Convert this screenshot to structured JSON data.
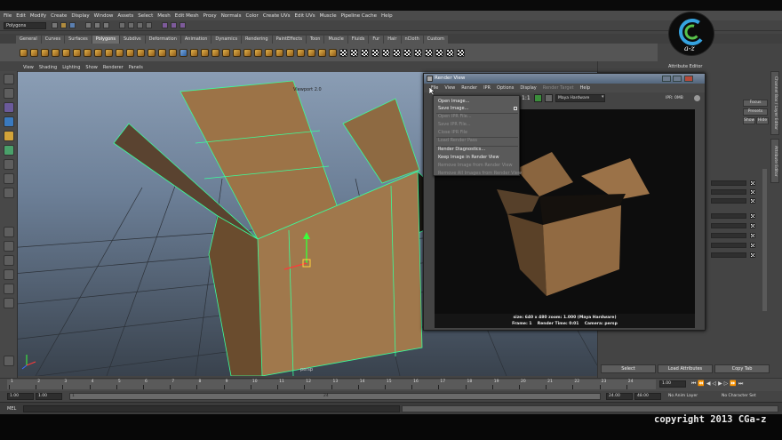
{
  "menubar": [
    "File",
    "Edit",
    "Modify",
    "Create",
    "Display",
    "Window",
    "Assets",
    "Select",
    "Mesh",
    "Edit Mesh",
    "Proxy",
    "Normals",
    "Color",
    "Create UVs",
    "Edit UVs",
    "Muscle",
    "Pipeline Cache",
    "Help"
  ],
  "mode_selector": "Polygons",
  "shelf_tabs": [
    "General",
    "Curves",
    "Surfaces",
    "Polygons",
    "Subdivs",
    "Deformation",
    "Animation",
    "Dynamics",
    "Rendering",
    "PaintEffects",
    "Toon",
    "Muscle",
    "Fluids",
    "Fur",
    "Hair",
    "nCloth",
    "Custom"
  ],
  "active_shelf_tab": "Polygons",
  "viewport": {
    "menu": [
      "View",
      "Shading",
      "Lighting",
      "Show",
      "Renderer",
      "Panels"
    ],
    "label": "Viewport 2.0",
    "bottom_label": "persp"
  },
  "render_view": {
    "title": "Render View",
    "menu": [
      "File",
      "View",
      "Render",
      "IPR",
      "Options",
      "Display",
      "Render Target",
      "Help"
    ],
    "renderer": "Maya Hardware",
    "ratio": "1:1",
    "ipr_memory": "IPR: 0MB",
    "info_line1": "size: 640 x 480  zoom: 1.000        (Maya Hardware)",
    "info_frame": "Frame: 1",
    "info_time": "Render Time: 0:01",
    "info_camera": "Camera: persp"
  },
  "file_menu": [
    {
      "label": "Open Image...",
      "enabled": true
    },
    {
      "label": "Save Image...",
      "enabled": true
    },
    {
      "label": "Open IPR File...",
      "enabled": false
    },
    {
      "label": "Save IPR File...",
      "enabled": false
    },
    {
      "label": "Close IPR File",
      "enabled": false
    },
    {
      "label": "Load Render Pass",
      "enabled": false
    },
    {
      "label": "Render Diagnostics...",
      "enabled": true
    },
    {
      "label": "Keep Image in Render View",
      "enabled": true
    },
    {
      "label": "Remove Image from Render View",
      "enabled": false
    },
    {
      "label": "Remove All Images from Render View",
      "enabled": false
    }
  ],
  "attribute_editor": {
    "title": "Attribute Editor",
    "focus": "Focus",
    "presets": "Presets",
    "show": "Show",
    "hide": "Hide",
    "select": "Select",
    "load_attributes": "Load Attributes",
    "copy_tab": "Copy Tab"
  },
  "side_tabs": [
    "Channel Box / Layer Editor",
    "Attribute Editor"
  ],
  "time_slider": {
    "ticks": [
      "1",
      "2",
      "3",
      "4",
      "5",
      "6",
      "7",
      "8",
      "9",
      "10",
      "11",
      "12",
      "13",
      "14",
      "15",
      "16",
      "17",
      "18",
      "19",
      "20",
      "21",
      "22",
      "23",
      "24"
    ],
    "current_frame": "1.00"
  },
  "range": {
    "start": "1.00",
    "playback_start": "1.00",
    "range_start_label": "1",
    "range_end_label": "24",
    "playback_end": "24.00",
    "end": "48.00",
    "anim_layer": "No Anim Layer",
    "char_set": "No Character Set"
  },
  "command_line": {
    "label": "MEL"
  },
  "copyright": "copyright 2013 CGa-z",
  "logo": {
    "text": "a-z"
  }
}
